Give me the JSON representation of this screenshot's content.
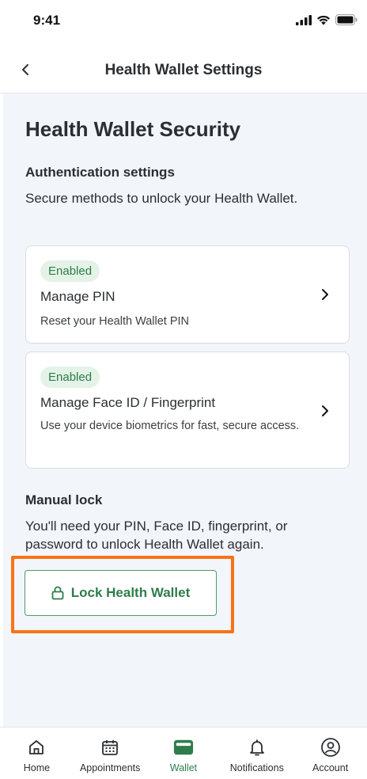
{
  "status_bar": {
    "time": "9:41"
  },
  "nav": {
    "title": "Health Wallet Settings"
  },
  "page": {
    "title": "Health Wallet Security",
    "auth_heading": "Authentication settings",
    "auth_body": "Secure methods to unlock your Health Wallet.",
    "manual_heading": "Manual lock",
    "manual_body": "You'll need your PIN, Face ID, fingerprint, or password to unlock Health Wallet again."
  },
  "cards": [
    {
      "badge": "Enabled",
      "title": "Manage PIN",
      "desc": "Reset your Health Wallet PIN"
    },
    {
      "badge": "Enabled",
      "title": "Manage Face ID / Fingerprint",
      "desc": "Use your device biometrics for fast, secure access."
    }
  ],
  "lock_button": {
    "label": "Lock Health Wallet"
  },
  "tabs": [
    {
      "label": "Home",
      "icon": "home-icon"
    },
    {
      "label": "Appointments",
      "icon": "calendar-icon"
    },
    {
      "label": "Wallet",
      "icon": "wallet-icon",
      "active": true
    },
    {
      "label": "Notifications",
      "icon": "bell-icon"
    },
    {
      "label": "Account",
      "icon": "account-icon"
    }
  ],
  "colors": {
    "accent": "#2e7d4a",
    "highlight": "#f97316",
    "background": "#f2f5f9"
  }
}
